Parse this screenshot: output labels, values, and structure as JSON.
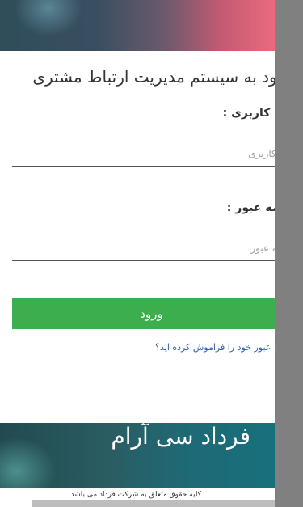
{
  "login": {
    "title": "ورود به سیستم مدیریت ارتباط مشتری",
    "username_label": "نام کاربری :",
    "username_placeholder": "نام کاربری",
    "password_label": "کلمه عبور :",
    "password_placeholder": "کلمه عبور",
    "submit_label": "ورود",
    "forgot_link": "کلمه عبور خود را فراموش کرده اید؟"
  },
  "brand": {
    "name": "فرداد سی آرام"
  },
  "footer": {
    "copyright": "کلیه حقوق متعلق به شرکت فرداد می باشد."
  },
  "colors": {
    "button": "#3cae4d",
    "link": "#2f5fb3",
    "panel": "#808080"
  }
}
